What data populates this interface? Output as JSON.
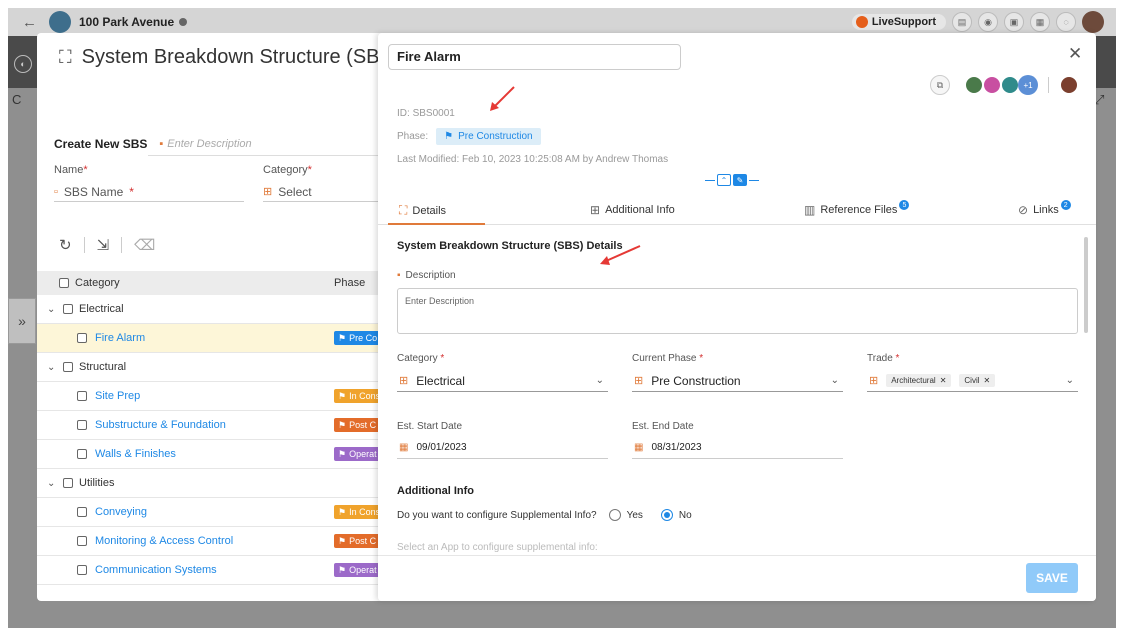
{
  "topbar": {
    "project_name": "100 Park Avenue",
    "live_support": "LiveSupport"
  },
  "left_panel": {
    "title": "System Breakdown Structure (SBS) Mana",
    "create_title": "Create New SBS",
    "create_desc_placeholder": "Enter Description",
    "name_label": "Name",
    "category_label": "Category",
    "name_placeholder": "SBS Name",
    "category_placeholder": "Select",
    "table_headers": [
      "Category",
      "Phase"
    ],
    "rows": [
      {
        "label": "Electrical",
        "type": "group"
      },
      {
        "label": "Fire Alarm",
        "type": "child",
        "phase": "Pre Co",
        "phase_color": "#1e88e5",
        "selected": true
      },
      {
        "label": "Structural",
        "type": "group"
      },
      {
        "label": "Site Prep",
        "type": "child",
        "phase": "In Cons",
        "phase_color": "#f0a32c"
      },
      {
        "label": "Substructure & Foundation",
        "type": "child",
        "phase": "Post C",
        "phase_color": "#e36c2a"
      },
      {
        "label": "Walls & Finishes",
        "type": "child",
        "phase": "Operat",
        "phase_color": "#9c6ac9"
      },
      {
        "label": "Utilities",
        "type": "group"
      },
      {
        "label": "Conveying",
        "type": "child",
        "phase": "In Cons",
        "phase_color": "#f0a32c"
      },
      {
        "label": "Monitoring & Access Control",
        "type": "child",
        "phase": "Post C",
        "phase_color": "#e36c2a"
      },
      {
        "label": "Communication Systems",
        "type": "child",
        "phase": "Operat",
        "phase_color": "#9c6ac9"
      }
    ]
  },
  "detail": {
    "title": "Fire Alarm",
    "id_label": "ID:",
    "id_value": "SBS0001",
    "phase_label": "Phase:",
    "phase_value": "Pre Construction",
    "last_modified": "Last Modified:  Feb 10, 2023 10:25:08 AM by Andrew Thomas",
    "more_count": "+1",
    "tabs": [
      {
        "label": "Details"
      },
      {
        "label": "Additional Info"
      },
      {
        "label": "Reference Files",
        "badge": "5"
      },
      {
        "label": "Links",
        "badge": "2"
      }
    ],
    "section_title": "System Breakdown Structure (SBS) Details",
    "description_label": "Description",
    "description_placeholder": "Enter Description",
    "category_label": "Category",
    "category_value": "Electrical",
    "current_phase_label": "Current Phase",
    "current_phase_value": "Pre Construction",
    "trade_label": "Trade",
    "trade_chips": [
      "Architectural",
      "Civil"
    ],
    "start_label": "Est. Start Date",
    "start_value": "09/01/2023",
    "end_label": "Est. End Date",
    "end_value": "08/31/2023",
    "additional_title": "Additional Info",
    "supplemental_question": "Do you want to configure Supplemental Info?",
    "yes_label": "Yes",
    "no_label": "No",
    "app_hint": "Select an App to configure supplemental info:",
    "save_label": "SAVE"
  },
  "colors": {
    "accent": "#1e88e5",
    "orange": "#e07a3a",
    "save": "#90caf9"
  }
}
